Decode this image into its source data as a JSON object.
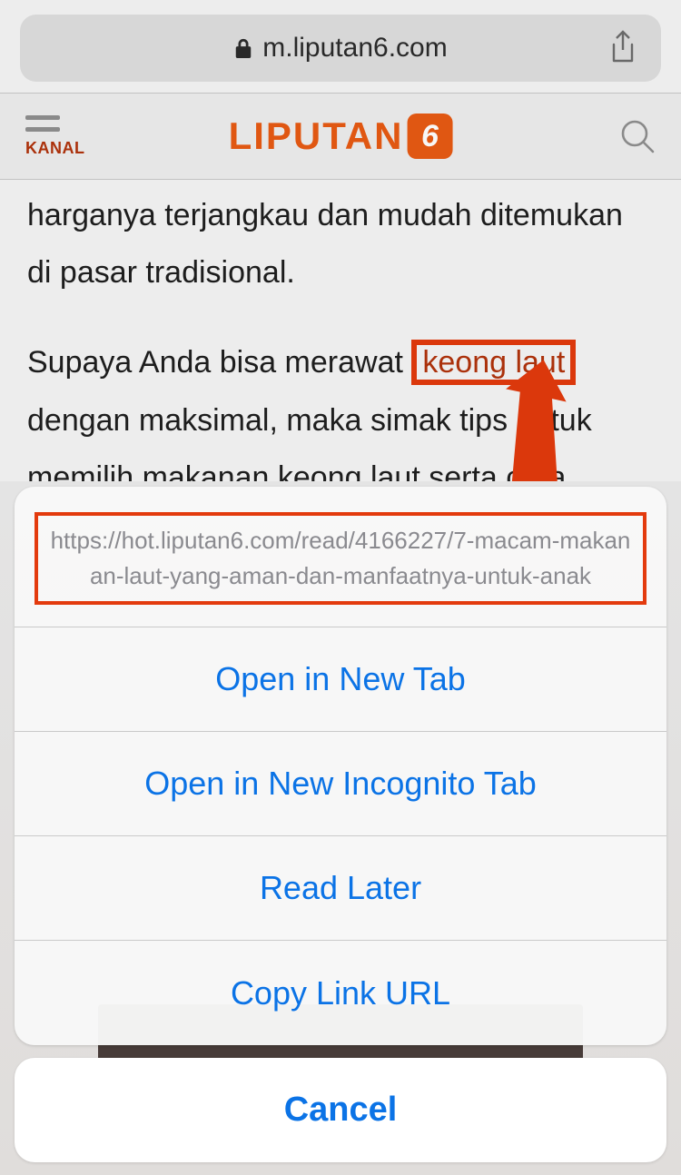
{
  "browser": {
    "domain": "m.liputan6.com"
  },
  "header": {
    "menu_label": "KANAL",
    "logo_text": "LIPUTAN",
    "logo_badge": "6"
  },
  "article": {
    "p1": "harganya terjangkau dan mudah ditemukan di pasar tradisional.",
    "p2_a": "Supaya Anda bisa merawat ",
    "link_text": "keong laut",
    "p2_b": " dengan maksimal, maka simak tips untuk memilih makanan keong laut serta cara"
  },
  "annotation": {
    "highlighted_phrase": "keong laut",
    "highlighted_url": "https://hot.liputan6.com/read/4166227/7-macam-makanan-laut-yang-aman-dan-manfaatnya-untuk-anak"
  },
  "sheet": {
    "url": "https://hot.liputan6.com/read/4166227/7-macam-makanan-laut-yang-aman-dan-manfaatnya-untuk-anak",
    "items": {
      "open_new_tab": "Open in New Tab",
      "open_incognito": "Open in New Incognito Tab",
      "read_later": "Read Later",
      "copy_link": "Copy Link URL"
    },
    "cancel": "Cancel"
  }
}
